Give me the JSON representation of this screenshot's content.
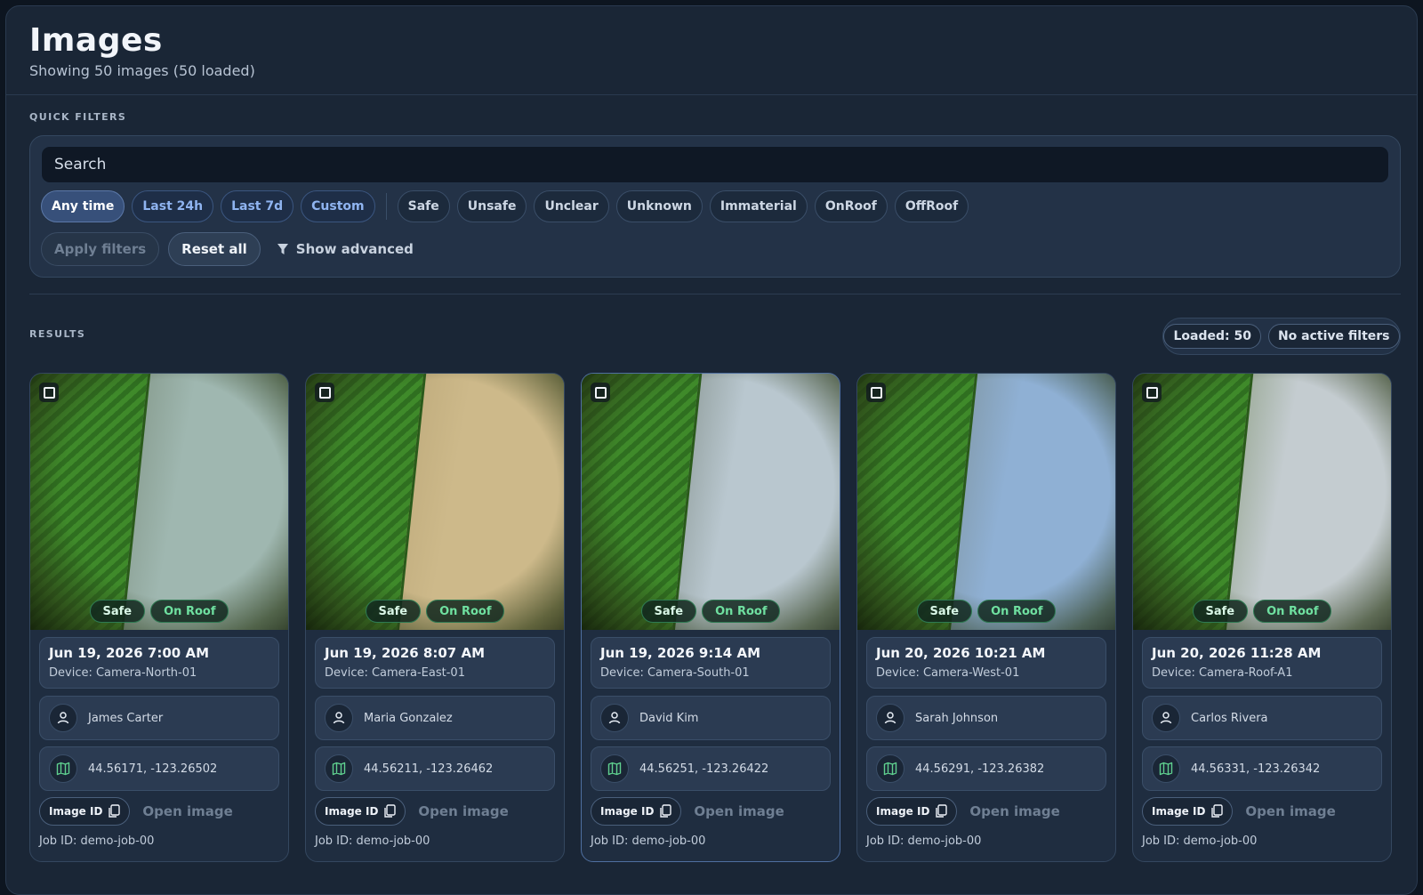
{
  "header": {
    "title": "Images",
    "subtitle": "Showing 50 images (50 loaded)"
  },
  "quick_filters": {
    "label": "QUICK FILTERS",
    "search_placeholder": "Search",
    "time_chips": [
      {
        "label": "Any time",
        "active": true
      },
      {
        "label": "Last 24h",
        "active": false
      },
      {
        "label": "Last 7d",
        "active": false
      },
      {
        "label": "Custom",
        "active": false
      }
    ],
    "class_chips": [
      "Safe",
      "Unsafe",
      "Unclear",
      "Unknown",
      "Immaterial",
      "OnRoof",
      "OffRoof"
    ],
    "apply_label": "Apply filters",
    "reset_label": "Reset all",
    "advanced_label": "Show advanced"
  },
  "results": {
    "label": "RESULTS",
    "loaded_pill": "Loaded: 50",
    "filters_pill": "No active filters",
    "cards": [
      {
        "datetime": "Jun 19, 2026 7:00 AM",
        "device": "Device: Camera-North-01",
        "user": "James Carter",
        "coords": "44.56171, -123.26502",
        "safety": "Safe",
        "location": "On Roof",
        "id_label": "Image ID",
        "open_label": "Open image",
        "job": "Job ID: demo-job-00",
        "sky": "#9fb7b0",
        "ground": "#5c6b52"
      },
      {
        "datetime": "Jun 19, 2026 8:07 AM",
        "device": "Device: Camera-East-01",
        "user": "Maria Gonzalez",
        "coords": "44.56211, -123.26462",
        "safety": "Safe",
        "location": "On Roof",
        "id_label": "Image ID",
        "open_label": "Open image",
        "job": "Job ID: demo-job-00",
        "sky": "#cdb98a",
        "ground": "#a89566"
      },
      {
        "datetime": "Jun 19, 2026 9:14 AM",
        "device": "Device: Camera-South-01",
        "user": "David Kim",
        "coords": "44.56251, -123.26422",
        "safety": "Safe",
        "location": "On Roof",
        "id_label": "Image ID",
        "open_label": "Open image",
        "job": "Job ID: demo-job-00",
        "sky": "#b9c7cf",
        "ground": "#4d5a48"
      },
      {
        "datetime": "Jun 20, 2026 10:21 AM",
        "device": "Device: Camera-West-01",
        "user": "Sarah Johnson",
        "coords": "44.56291, -123.26382",
        "safety": "Safe",
        "location": "On Roof",
        "id_label": "Image ID",
        "open_label": "Open image",
        "job": "Job ID: demo-job-00",
        "sky": "#8fb0d4",
        "ground": "#6a7360"
      },
      {
        "datetime": "Jun 20, 2026 11:28 AM",
        "device": "Device: Camera-Roof-A1",
        "user": "Carlos Rivera",
        "coords": "44.56331, -123.26342",
        "safety": "Safe",
        "location": "On Roof",
        "id_label": "Image ID",
        "open_label": "Open image",
        "job": "Job ID: demo-job-00",
        "sky": "#c4ccd0",
        "ground": "#4f6b2e"
      }
    ]
  }
}
